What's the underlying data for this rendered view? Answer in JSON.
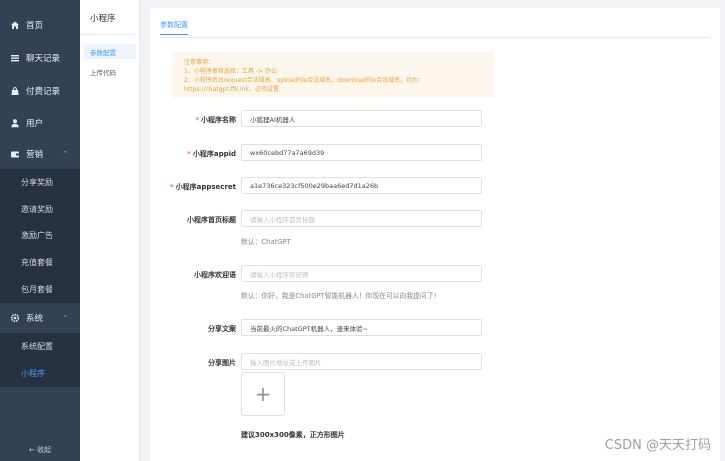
{
  "sidebar": {
    "items": [
      {
        "label": "首页",
        "icon": "home-icon"
      },
      {
        "label": "聊天记录",
        "icon": "list-icon"
      },
      {
        "label": "付费记录",
        "icon": "bag-icon"
      },
      {
        "label": "用户",
        "icon": "user-icon"
      },
      {
        "label": "营销",
        "icon": "wallet-icon",
        "expanded": true
      }
    ],
    "marketing_subitems": [
      "分享奖励",
      "邀请奖励",
      "激励广告",
      "充值套餐",
      "包月套餐"
    ],
    "system": {
      "label": "系统",
      "icon": "gear-icon",
      "expanded": true
    },
    "system_subitems": [
      {
        "label": "系统配置",
        "active": false
      },
      {
        "label": "小程序",
        "active": true
      }
    ],
    "collapse_label": "← 收起"
  },
  "subnav": {
    "title": "小程序",
    "links": [
      {
        "label": "参数配置",
        "active": true
      },
      {
        "label": "上传代码",
        "active": false
      }
    ]
  },
  "main": {
    "tab": "参数配置",
    "notice": [
      "注意事项：",
      "1、小程序类目选择：工具 -> 办公",
      "2、小程序后台request合法域名、uploadFile合法域名、downloadFile合法域名，均为：",
      "https://chatgpt.ffk.ink，必须设置"
    ],
    "form": {
      "name": {
        "label": "小程序名称",
        "required": true,
        "value": "小狐狸AI机器人"
      },
      "appid": {
        "label": "小程序appid",
        "required": true,
        "value": "wx60cebd77a7a69d39"
      },
      "appsecret": {
        "label": "小程序appsecret",
        "required": true,
        "value": "a1e736ce323cf500e29baa6ed7d1a26b"
      },
      "home_title": {
        "label": "小程序首页标题",
        "placeholder": "请输入小程序首页标题",
        "hint": "默认：ChatGPT"
      },
      "welcome": {
        "label": "小程序欢迎语",
        "placeholder": "请输入小程序欢迎语",
        "hint": "默认：你好，我是ChatGPT智能机器人！你现在可以向我提问了！"
      },
      "share_text": {
        "label": "分享文案",
        "value": "当前最火的ChatGPT机器人，速来体验~"
      },
      "share_image": {
        "label": "分享图片",
        "placeholder": "输入图片地址或上传图片",
        "upload_symbol": "+",
        "note": "建议300x300像素，正方形图片"
      }
    }
  },
  "watermark": "CSDN @天天打码",
  "colors": {
    "sidebar": "#334155",
    "accent": "#409eff",
    "required": "#f56c6c",
    "notice_bg": "#fdf6ec",
    "notice_text": "#e6a23c"
  }
}
